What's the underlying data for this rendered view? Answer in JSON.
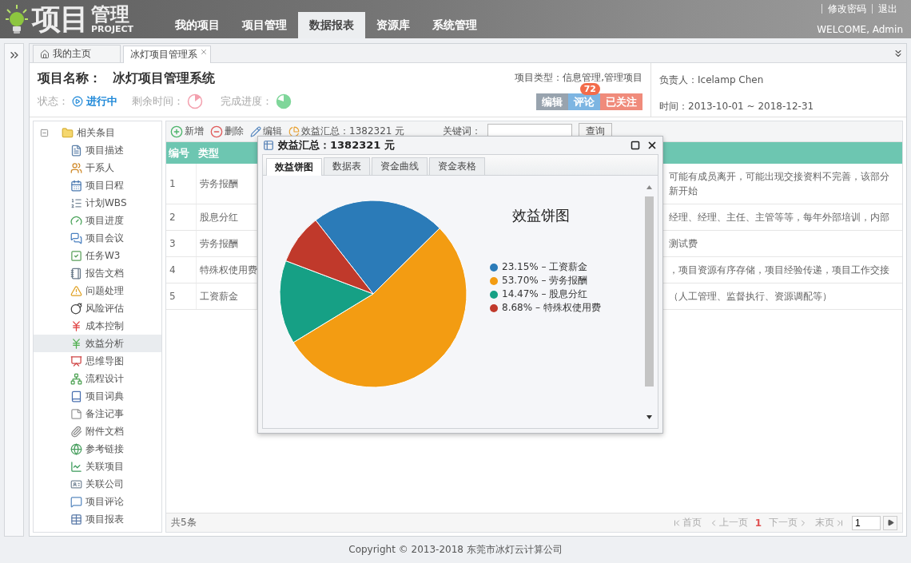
{
  "header": {
    "logo": {
      "main": "项目",
      "side": "管理",
      "sub": "PROJECT"
    },
    "nav": [
      {
        "label": "我的项目",
        "selected": false
      },
      {
        "label": "项目管理",
        "selected": false
      },
      {
        "label": "数据报表",
        "selected": true
      },
      {
        "label": "资源库",
        "selected": false
      },
      {
        "label": "系统管理",
        "selected": false
      }
    ],
    "links": [
      "修改密码",
      "退出"
    ],
    "welcome": "WELCOME, Admin"
  },
  "tabs": [
    {
      "label": "我的主页",
      "selected": false,
      "kind": "home"
    },
    {
      "label": "冰灯项目管理系",
      "selected": true,
      "kind": "closable"
    }
  ],
  "project": {
    "name_label": "项目名称：",
    "name": "冰灯项目管理系统",
    "status_label": "状态：",
    "status": "进行中",
    "remaining_label": "剩余时间：",
    "progress_label": "完成进度：",
    "type": "项目类型：信息管理,管理项目",
    "buttons": [
      {
        "label": "编辑",
        "kind": "edit"
      },
      {
        "label": "评论",
        "kind": "comment",
        "badge": "72"
      },
      {
        "label": "已关注",
        "kind": "follow"
      }
    ],
    "owner": "负责人：Icelamp Chen",
    "period": "时间：2013-10-01 ~ 2018-12-31"
  },
  "tree": {
    "label": "相关条目",
    "expanded": true,
    "children": [
      {
        "label": "项目描述",
        "selected": false
      },
      {
        "label": "干系人",
        "selected": false
      },
      {
        "label": "项目日程",
        "selected": false
      },
      {
        "label": "计划WBS",
        "selected": false
      },
      {
        "label": "项目进度",
        "selected": false
      },
      {
        "label": "项目会议",
        "selected": false
      },
      {
        "label": "任务W3",
        "selected": false
      },
      {
        "label": "报告文档",
        "selected": false
      },
      {
        "label": "问题处理",
        "selected": false
      },
      {
        "label": "风险评估",
        "selected": false
      },
      {
        "label": "成本控制",
        "selected": false
      },
      {
        "label": "效益分析",
        "selected": true
      },
      {
        "label": "思维导图",
        "selected": false
      },
      {
        "label": "流程设计",
        "selected": false
      },
      {
        "label": "项目词典",
        "selected": false
      },
      {
        "label": "备注记事",
        "selected": false
      },
      {
        "label": "附件文档",
        "selected": false
      },
      {
        "label": "参考链接",
        "selected": false
      },
      {
        "label": "关联项目",
        "selected": false
      },
      {
        "label": "关联公司",
        "selected": false
      },
      {
        "label": "项目评论",
        "selected": false
      },
      {
        "label": "项目报表",
        "selected": false
      }
    ]
  },
  "toolbar": {
    "actions": [
      {
        "label": "新增",
        "kind": "add"
      },
      {
        "label": "删除",
        "kind": "delete"
      },
      {
        "label": "编辑",
        "kind": "edit"
      },
      {
        "label": "效益汇总：1382321 元",
        "kind": "summary"
      }
    ],
    "keyword_label": "关键词：",
    "search_button": "查询"
  },
  "table": {
    "columns": [
      "编号",
      "类型"
    ],
    "rows": [
      {
        "no": "1",
        "type": "劳务报酬",
        "column_3": "可能有成员离开，可能出现交接资料不完善，该部分新开始"
      },
      {
        "no": "2",
        "type": "股息分红",
        "column_3": "经理、经理、主任、主管等等，每年外部培训，内部"
      },
      {
        "no": "3",
        "type": "劳务报酬",
        "column_3": "测试费"
      },
      {
        "no": "4",
        "type": "特殊权使用费",
        "column_3": "，项目资源有序存储，项目经验传递，项目工作交接"
      },
      {
        "no": "5",
        "type": "工资薪金",
        "column_3": "（人工管理、监督执行、资源调配等）"
      }
    ]
  },
  "pager": {
    "total": "共5条",
    "first": "首页",
    "prev": "上一页",
    "current": "1",
    "next": "下一页",
    "last": "末页",
    "page_input": "1"
  },
  "dialog": {
    "title": "效益汇总：1382321 元",
    "tabs": [
      {
        "label": "效益饼图",
        "selected": true
      },
      {
        "label": "数据表",
        "selected": false
      },
      {
        "label": "资金曲线",
        "selected": false
      },
      {
        "label": "资金表格",
        "selected": false
      }
    ],
    "chart_data": {
      "type": "pie",
      "title": "效益饼图",
      "legend": "right",
      "categories": [
        "23.15% – 工资薪金",
        "53.70% – 劳务报酬",
        "14.47% – 股息分红",
        "8.68% – 特殊权使用费"
      ],
      "values": [
        23.15,
        53.7,
        14.47,
        8.68
      ]
    },
    "legend": [
      {
        "color": "#2b7bb8"
      },
      {
        "color": "#f39c12"
      },
      {
        "color": "#16a085"
      },
      {
        "color": "#c0392b"
      }
    ]
  },
  "footer": "Copyright © 2013-2018 东莞市冰灯云计算公司"
}
